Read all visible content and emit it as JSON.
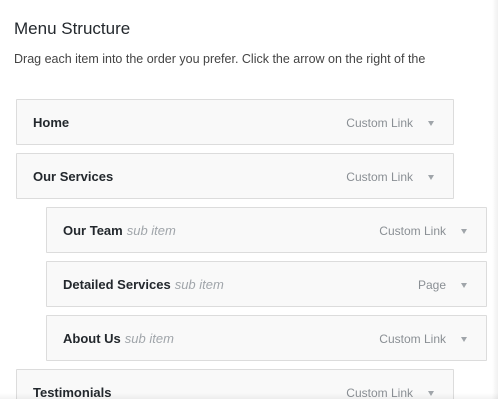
{
  "header": {
    "title": "Menu Structure",
    "instructions": "Drag each item into the order you prefer. Click the arrow on the right of the"
  },
  "menu": {
    "items": [
      {
        "title": "Home",
        "sub_label": "",
        "type": "Custom Link",
        "level": 0
      },
      {
        "title": "Our Services",
        "sub_label": "",
        "type": "Custom Link",
        "level": 0
      },
      {
        "title": "Our Team",
        "sub_label": "sub item",
        "type": "Custom Link",
        "level": 1
      },
      {
        "title": "Detailed Services",
        "sub_label": "sub item",
        "type": "Page",
        "level": 1
      },
      {
        "title": "About Us",
        "sub_label": "sub item",
        "type": "Custom Link",
        "level": 1
      },
      {
        "title": "Testimonials",
        "sub_label": "",
        "type": "Custom Link",
        "level": 0
      }
    ]
  },
  "icons": {
    "expand": "chevron-down-icon"
  },
  "colors": {
    "item_background": "#f9f9f9",
    "item_border": "#dcdcdc",
    "title_text": "#23282d",
    "muted_text": "#a0a5aa"
  }
}
